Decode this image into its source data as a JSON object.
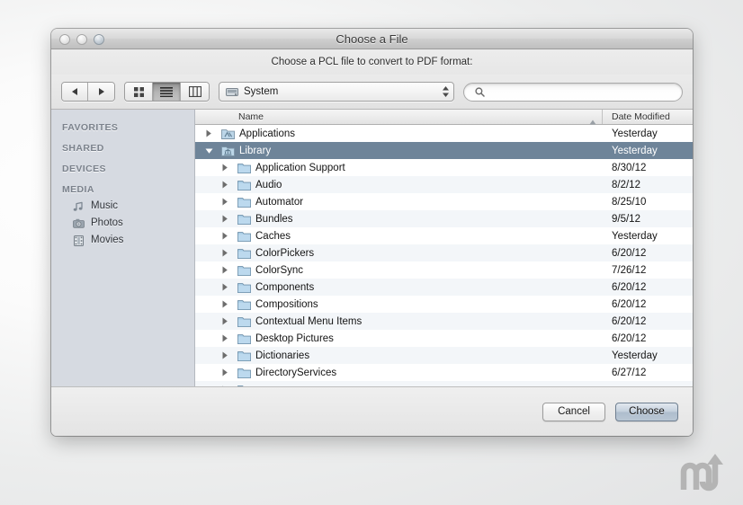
{
  "window": {
    "title": "Choose a File",
    "prompt": "Choose a PCL file to convert to PDF format:"
  },
  "toolbar": {
    "back_icon": "back-arrow-icon",
    "forward_icon": "forward-arrow-icon",
    "view_icon_label": "icon-view-icon",
    "view_list_label": "list-view-icon",
    "view_column_label": "column-view-icon",
    "path_popup_value": "System",
    "path_popup_icon": "hard-drive-icon",
    "search_placeholder": "",
    "search_value": "",
    "search_icon": "search-icon"
  },
  "sidebar": {
    "groups": [
      {
        "header": "FAVORITES",
        "items": []
      },
      {
        "header": "SHARED",
        "items": []
      },
      {
        "header": "DEVICES",
        "items": []
      },
      {
        "header": "MEDIA",
        "items": [
          {
            "label": "Music",
            "icon": "music-note-icon"
          },
          {
            "label": "Photos",
            "icon": "camera-icon"
          },
          {
            "label": "Movies",
            "icon": "film-strip-icon"
          }
        ]
      }
    ]
  },
  "list": {
    "columns": {
      "name": "Name",
      "date": "Date Modified"
    },
    "sort_direction": "ascending",
    "rows": [
      {
        "name": "Applications",
        "date": "Yesterday",
        "indent": 0,
        "disclosure": "collapsed",
        "icon": "applications-folder-icon",
        "selected": false
      },
      {
        "name": "Library",
        "date": "Yesterday",
        "indent": 0,
        "disclosure": "expanded",
        "icon": "library-folder-icon",
        "selected": true
      },
      {
        "name": "Application Support",
        "date": "8/30/12",
        "indent": 1,
        "disclosure": "collapsed",
        "icon": "folder-icon",
        "selected": false
      },
      {
        "name": "Audio",
        "date": "8/2/12",
        "indent": 1,
        "disclosure": "collapsed",
        "icon": "folder-icon",
        "selected": false
      },
      {
        "name": "Automator",
        "date": "8/25/10",
        "indent": 1,
        "disclosure": "collapsed",
        "icon": "folder-icon",
        "selected": false
      },
      {
        "name": "Bundles",
        "date": "9/5/12",
        "indent": 1,
        "disclosure": "collapsed",
        "icon": "folder-icon",
        "selected": false
      },
      {
        "name": "Caches",
        "date": "Yesterday",
        "indent": 1,
        "disclosure": "collapsed",
        "icon": "folder-icon",
        "selected": false
      },
      {
        "name": "ColorPickers",
        "date": "6/20/12",
        "indent": 1,
        "disclosure": "collapsed",
        "icon": "folder-icon",
        "selected": false
      },
      {
        "name": "ColorSync",
        "date": "7/26/12",
        "indent": 1,
        "disclosure": "collapsed",
        "icon": "folder-icon",
        "selected": false
      },
      {
        "name": "Components",
        "date": "6/20/12",
        "indent": 1,
        "disclosure": "collapsed",
        "icon": "folder-icon",
        "selected": false
      },
      {
        "name": "Compositions",
        "date": "6/20/12",
        "indent": 1,
        "disclosure": "collapsed",
        "icon": "folder-icon",
        "selected": false
      },
      {
        "name": "Contextual Menu Items",
        "date": "6/20/12",
        "indent": 1,
        "disclosure": "collapsed",
        "icon": "folder-icon",
        "selected": false
      },
      {
        "name": "Desktop Pictures",
        "date": "6/20/12",
        "indent": 1,
        "disclosure": "collapsed",
        "icon": "folder-icon",
        "selected": false
      },
      {
        "name": "Dictionaries",
        "date": "Yesterday",
        "indent": 1,
        "disclosure": "collapsed",
        "icon": "folder-icon",
        "selected": false
      },
      {
        "name": "DirectoryServices",
        "date": "6/27/12",
        "indent": 1,
        "disclosure": "collapsed",
        "icon": "folder-icon",
        "selected": false
      },
      {
        "name": "",
        "date": "",
        "indent": 1,
        "disclosure": "collapsed",
        "icon": "folder-icon",
        "selected": false
      }
    ]
  },
  "buttons": {
    "cancel": "Cancel",
    "choose": "Choose"
  },
  "watermark": {
    "name": "macupdate-logo"
  },
  "colors": {
    "selection": "#6e8499",
    "sidebar_bg": "#d6dae1",
    "folder_blue": "#9fc4de",
    "default_button": "#aebdcd"
  }
}
